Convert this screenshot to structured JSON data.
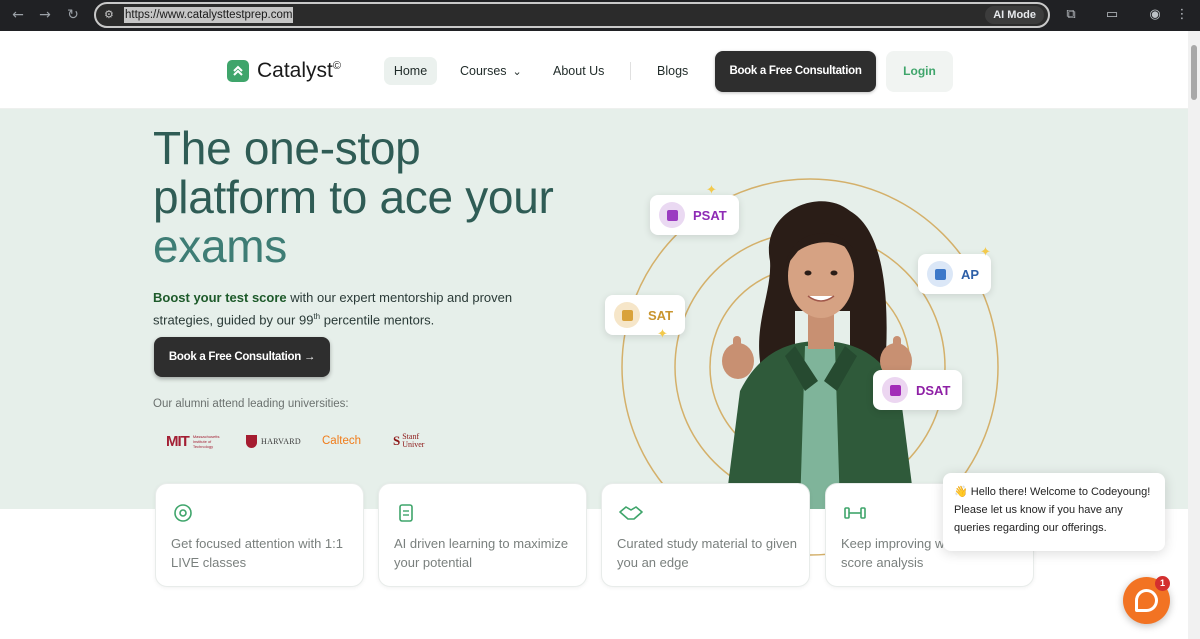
{
  "browser": {
    "url": "https://www.catalysttestprep.com",
    "ai_mode_label": "AI Mode",
    "nav_icons": [
      "back-arrow-icon",
      "forward-arrow-icon",
      "reload-icon"
    ],
    "toolbar_icons": [
      "extensions-icon",
      "cast-icon",
      "profile-icon",
      "menu-icon"
    ]
  },
  "nav": {
    "logo_text": "Catalyst",
    "logo_mark": "©",
    "home": "Home",
    "courses": "Courses",
    "about": "About Us",
    "blogs": "Blogs",
    "consult_button": "Book a Free Consultation",
    "login_button": "Login"
  },
  "hero": {
    "title_line1": "The one-stop",
    "title_line2": "platform to ace your",
    "title_line3": "exams",
    "sub_bold": "Boost your test score",
    "sub_rest": " with our expert mentorship and proven strategies, guided by our 99",
    "sub_sup": "th",
    "sub_end": " percentile mentors.",
    "cta": "Book a Free Consultation →",
    "alumni_text": "Our alumni attend leading universities:",
    "universities": {
      "mit": "MIT",
      "mit_sub": "Massachusetts Institute of Technology",
      "harvard": "HARVARD",
      "caltech": "Caltech",
      "stanford": "Stanf",
      "stanford_sub": "Univer"
    }
  },
  "badges": {
    "psat": "PSAT",
    "ap": "AP",
    "sat": "SAT",
    "dsat": "DSAT"
  },
  "features": [
    {
      "icon": "target-icon",
      "text": "Get focused attention with 1:1 LIVE classes"
    },
    {
      "icon": "document-icon",
      "text": "AI driven learning to maximize your potential"
    },
    {
      "icon": "handshake-icon",
      "text": "Curated study material to given you an edge"
    },
    {
      "icon": "dumbbell-icon",
      "text": "Keep improving w"
    },
    {
      "icon": "",
      "text": "score analysis"
    }
  ],
  "chat": {
    "greeting": "👋 Hello there! Welcome to Codeyoung! Please let us know if you have any queries regarding our offerings.",
    "badge_count": "1"
  },
  "colors": {
    "brand_green": "#3fa56b",
    "title_teal": "#2f5c55",
    "hero_bg": "#e6efea",
    "dark_button": "#2e2e2e",
    "chat_orange": "#f27323"
  }
}
